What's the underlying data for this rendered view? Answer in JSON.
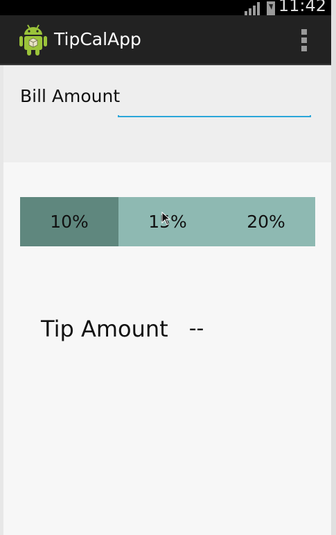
{
  "status_bar": {
    "time": "11:42"
  },
  "action_bar": {
    "title": "TipCalApp",
    "app_icon": "android-robot-icon",
    "overflow_icon": "overflow-menu-icon"
  },
  "bill": {
    "label": "Bill Amount",
    "value": "",
    "placeholder": ""
  },
  "tip_options": [
    {
      "label": "10%",
      "selected": true
    },
    {
      "label": "15%",
      "selected": false
    },
    {
      "label": "20%",
      "selected": false
    }
  ],
  "tip": {
    "label": "Tip Amount",
    "value": "--"
  },
  "colors": {
    "action_bar": "#222222",
    "accent_underline": "#2aa6d9",
    "tip_selected": "#5f877e",
    "tip_unselected": "#8eb9b2"
  }
}
